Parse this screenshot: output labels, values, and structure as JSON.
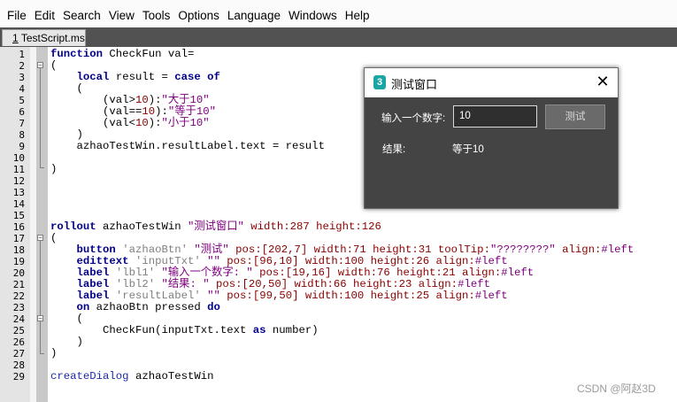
{
  "menu": [
    "File",
    "Edit",
    "Search",
    "View",
    "Tools",
    "Options",
    "Language",
    "Windows",
    "Help"
  ],
  "tab": {
    "number": "1",
    "name": "TestScript.ms"
  },
  "line_numbers": [
    "1",
    "2",
    "3",
    "4",
    "5",
    "6",
    "7",
    "8",
    "9",
    "10",
    "11",
    "12",
    "13",
    "14",
    "15",
    "16",
    "17",
    "18",
    "19",
    "20",
    "21",
    "22",
    "23",
    "24",
    "25",
    "26",
    "27",
    "28",
    "29"
  ],
  "code": {
    "l1_kw": "function",
    "l1_rest": " CheckFun val=",
    "l2": "(",
    "l3_kw1": "local",
    "l3_mid": " result = ",
    "l3_kw2": "case of",
    "l4": "(",
    "l5_a": "(val>",
    "l5_num": "10",
    "l5_b": "):",
    "l5_str": "\"大于10\"",
    "l6_a": "(val==",
    "l6_num": "10",
    "l6_b": "):",
    "l6_str": "\"等于10\"",
    "l7_a": "(val<",
    "l7_num": "10",
    "l7_b": "):",
    "l7_str": "\"小于10\"",
    "l8": ")",
    "l9": "azhaoTestWin.resultLabel.text = result",
    "l10": ")",
    "l16_kw": "rollout",
    "l16_id": " azhaoTestWin ",
    "l16_str": "\"测试窗口\"",
    "l16_p1": " width:",
    "l16_n1": "287",
    "l16_p2": " height:",
    "l16_n2": "126",
    "l17": "(",
    "l18_kw": "button",
    "l18_nm": " 'azhaoBtn' ",
    "l18_str": "\"测试\"",
    "l18_p1": " pos:",
    "l18_v1": "[202,7]",
    "l18_p2": " width:",
    "l18_n2": "71",
    "l18_p3": " height:",
    "l18_n3": "31",
    "l18_p4": " toolTip:",
    "l18_s4": "\"????????\"",
    "l18_p5": " align:",
    "l18_v5": "#left",
    "l19_kw": "edittext",
    "l19_nm": " 'inputTxt' ",
    "l19_str": "\"\"",
    "l19_p1": " pos:",
    "l19_v1": "[96,10]",
    "l19_p2": " width:",
    "l19_n2": "100",
    "l19_p3": " height:",
    "l19_n3": "26",
    "l19_p4": " align:",
    "l19_v4": "#left",
    "l20_kw": "label",
    "l20_nm": " 'lbl1' ",
    "l20_str": "\"输入一个数字: \"",
    "l20_p1": " pos:",
    "l20_v1": "[19,16]",
    "l20_p2": " width:",
    "l20_n2": "76",
    "l20_p3": " height:",
    "l20_n3": "21",
    "l20_p4": " align:",
    "l20_v4": "#left",
    "l21_kw": "label",
    "l21_nm": " 'lbl2' ",
    "l21_str": "\"结果: \"",
    "l21_p1": " pos:",
    "l21_v1": "[20,50]",
    "l21_p2": " width:",
    "l21_n2": "66",
    "l21_p3": " height:",
    "l21_n3": "23",
    "l21_p4": " align:",
    "l21_v4": "#left",
    "l22_kw": "label",
    "l22_nm": " 'resultLabel' ",
    "l22_str": "\"\"",
    "l22_p1": " pos:",
    "l22_v1": "[99,50]",
    "l22_p2": " width:",
    "l22_n2": "100",
    "l22_p3": " height:",
    "l22_n3": "25",
    "l22_p4": " align:",
    "l22_v4": "#left",
    "l23_kw1": "on",
    "l23_mid": " azhaoBtn pressed ",
    "l23_kw2": "do",
    "l24": "(",
    "l25_a": "CheckFun(inputTxt.text ",
    "l25_kw": "as",
    "l25_b": " number)",
    "l26": ")",
    "l27": ")",
    "l29_fn": "createDialog",
    "l29_rest": " azhaoTestWin"
  },
  "dialog": {
    "title": "测试窗口",
    "icon": "3ds-max-icon",
    "input_label": "输入一个数字:",
    "input_value": "10",
    "button_label": "测试",
    "result_label": "结果:",
    "result_value": "等于10",
    "close_glyph": "✕"
  },
  "watermark": "CSDN @阿赵3D",
  "colors": {
    "keyword": "#00008b",
    "string": "#800080",
    "number": "#8b0000",
    "dialog_bg": "#444444"
  }
}
